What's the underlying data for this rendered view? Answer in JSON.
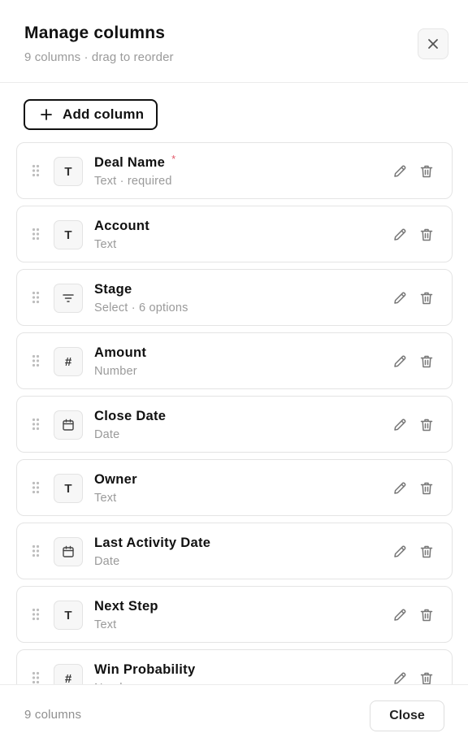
{
  "header": {
    "title": "Manage columns",
    "subtitle": "9 columns · drag to reorder",
    "close_icon": "close-icon"
  },
  "toolbar": {
    "add_label": "Add column",
    "add_icon": "plus-icon"
  },
  "columns": [
    {
      "name": "Deal Name",
      "meta": "Text · required",
      "required": true,
      "type_icon": "text-icon"
    },
    {
      "name": "Account",
      "meta": "Text",
      "required": false,
      "type_icon": "text-icon"
    },
    {
      "name": "Stage",
      "meta": "Select · 6 options",
      "required": false,
      "type_icon": "filter-icon"
    },
    {
      "name": "Amount",
      "meta": "Number",
      "required": false,
      "type_icon": "hash-icon"
    },
    {
      "name": "Close Date",
      "meta": "Date",
      "required": false,
      "type_icon": "calendar-icon"
    },
    {
      "name": "Owner",
      "meta": "Text",
      "required": false,
      "type_icon": "text-icon"
    },
    {
      "name": "Last Activity Date",
      "meta": "Date",
      "required": false,
      "type_icon": "calendar-icon"
    },
    {
      "name": "Next Step",
      "meta": "Text",
      "required": false,
      "type_icon": "text-icon"
    },
    {
      "name": "Win Probability",
      "meta": "Number",
      "required": false,
      "type_icon": "hash-icon"
    }
  ],
  "required_marker": "*",
  "row_icons": {
    "drag": "drag-handle-icon",
    "edit": "pencil-icon",
    "delete": "trash-icon"
  },
  "footer": {
    "count_label": "9 columns",
    "close_label": "Close"
  },
  "colors": {
    "required": "#e35a6a",
    "muted_text": "#9a9a9a",
    "border": "#e4e4e4"
  }
}
